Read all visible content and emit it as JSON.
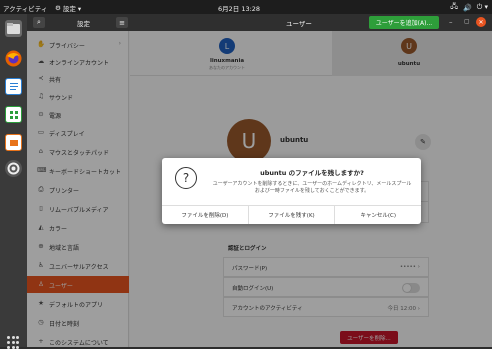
{
  "topbar": {
    "activities": "アクティビティ",
    "app_label": "設定 ▾",
    "clock": "6月2日 13:28",
    "tray": [
      "🖧",
      "🔊",
      "⏻ ▾"
    ]
  },
  "dock": {
    "items": [
      "files-icon",
      "firefox-icon",
      "writer-icon",
      "calc-icon",
      "impress-icon",
      "settings-icon"
    ]
  },
  "header": {
    "left_title": "設定",
    "center_title": "ユーザー",
    "add_user_label": "ユーザーを追加(A)...",
    "minimize": "–",
    "maximize": "▢",
    "close": "✕"
  },
  "sidebar": {
    "items": [
      {
        "icon": "✋",
        "label": "プライバシー",
        "chevron": "›"
      },
      {
        "icon": "☁",
        "label": "オンラインアカウント"
      },
      {
        "icon": "≺",
        "label": "共有"
      },
      {
        "icon": "♫",
        "label": "サウンド"
      },
      {
        "icon": "⊙",
        "label": "電源"
      },
      {
        "icon": "▭",
        "label": "ディスプレイ"
      },
      {
        "icon": "⌂",
        "label": "マウスとタッチパッド"
      },
      {
        "icon": "⌨",
        "label": "キーボードショートカット"
      },
      {
        "icon": "⎙",
        "label": "プリンター"
      },
      {
        "icon": "▯",
        "label": "リムーバブルメディア"
      },
      {
        "icon": "◭",
        "label": "カラー"
      },
      {
        "icon": "⊕",
        "label": "地域と言語"
      },
      {
        "icon": "♿",
        "label": "ユニバーサルアクセス"
      },
      {
        "icon": "♙",
        "label": "ユーザー"
      },
      {
        "icon": "★",
        "label": "デフォルトのアプリ"
      },
      {
        "icon": "◷",
        "label": "日付と時刻"
      },
      {
        "icon": "+",
        "label": "このシステムについて"
      }
    ]
  },
  "users": [
    {
      "initial": "L",
      "name": "linuxmania",
      "sub": "あなたのアカウント",
      "color": "#1f5fbf"
    },
    {
      "initial": "U",
      "name": "ubuntu",
      "color": "#9a5a2c"
    }
  ],
  "profile": {
    "initial": "U",
    "name": "ubuntu",
    "edit_icon": "✎"
  },
  "auth": {
    "section_title": "認証とログイン",
    "password_label": "パスワード(P)",
    "password_value": "••••• ›",
    "autologin_label": "自動ログイン(U)",
    "activity_label": "アカウントのアクティビティ",
    "activity_value": "今日 12:00 ›",
    "delete_label": "ユーザーを削除..."
  },
  "dialog": {
    "icon": "?",
    "title": "ubuntu のファイルを残しますか?",
    "message": "ユーザーアカウントを削除するときに、ユーザーのホームディレクトリ、メールスプールおよび一時ファイルを残しておくことができます。",
    "btn_delete": "ファイルを削除(D)",
    "btn_keep": "ファイルを残す(K)",
    "btn_cancel": "キャンセル(C)"
  }
}
